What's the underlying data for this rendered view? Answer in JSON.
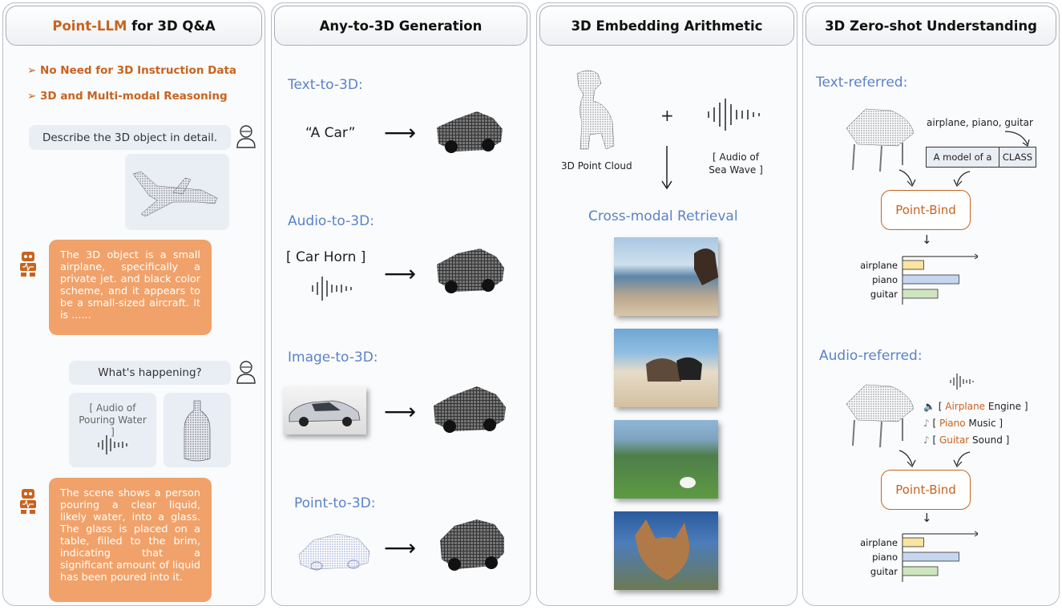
{
  "panels": {
    "qa": {
      "title_accent": "Point-LLM",
      "title_rest": " for 3D Q&A",
      "bullets": [
        "No Need for 3D Instruction Data",
        "3D and Multi-modal Reasoning"
      ],
      "q1": "Describe the 3D object in detail.",
      "a1": "The 3D object is a small airplane, specifically a private jet. and black color scheme, and it appears to be a small-sized aircraft. It is ......",
      "q2": "What's happening?",
      "audio_label": "[ Audio of Pouring Water ]",
      "a2": "The scene shows a person pouring a clear liquid, likely water, into a glass. The glass is placed on a table, filled to the brim, indicating that a significant amount of liquid has been poured into it."
    },
    "gen": {
      "title": "Any-to-3D Generation",
      "text_to_3d": "Text-to-3D:",
      "text_prompt": "“A Car”",
      "audio_to_3d": "Audio-to-3D:",
      "audio_prompt": "[ Car Horn ]",
      "image_to_3d": "Image-to-3D:",
      "point_to_3d": "Point-to-3D:"
    },
    "arith": {
      "title": "3D Embedding Arithmetic",
      "plus": "+",
      "point_cloud_label": "3D Point Cloud",
      "audio_label": "[ Audio of Sea Wave ]",
      "retrieval_title": "Cross-modal Retrieval"
    },
    "zeroshot": {
      "title": "3D Zero-shot Understanding",
      "text_referred": "Text-referred:",
      "classes_text": "airplane, piano, guitar",
      "template_prefix": "A model of a",
      "template_class": "CLASS",
      "pointbind": "Point-Bind",
      "bar_labels": [
        "airplane",
        "piano",
        "guitar"
      ],
      "audio_referred": "Audio-referred:",
      "audio_items": [
        {
          "open": "[ ",
          "name": "Airplane",
          "rest": " Engine ]"
        },
        {
          "open": "[ ",
          "name": "Piano",
          "rest": " Music ]"
        },
        {
          "open": "[ ",
          "name": "Guitar",
          "rest": " Sound ]"
        }
      ]
    }
  },
  "chart_data": [
    {
      "type": "bar",
      "orientation": "horizontal",
      "categories": [
        "airplane",
        "piano",
        "guitar"
      ],
      "values": [
        0.3,
        0.8,
        0.5
      ],
      "colors": [
        "#fbe3a0",
        "#c6d6ee",
        "#cfe5bf"
      ]
    },
    {
      "type": "bar",
      "orientation": "horizontal",
      "categories": [
        "airplane",
        "piano",
        "guitar"
      ],
      "values": [
        0.3,
        0.8,
        0.5
      ],
      "colors": [
        "#fbe3a0",
        "#c6d6ee",
        "#cfe5bf"
      ]
    }
  ]
}
